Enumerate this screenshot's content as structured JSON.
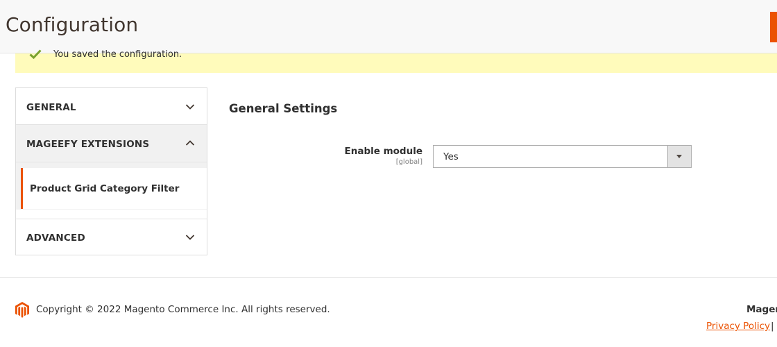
{
  "header": {
    "title": "Configuration"
  },
  "message": {
    "text": "You saved the configuration."
  },
  "sidebar": {
    "sections": [
      {
        "label": "GENERAL",
        "expanded": false
      },
      {
        "label": "MAGEEFY EXTENSIONS",
        "expanded": true,
        "items": [
          {
            "label": "Product Grid Category Filter",
            "active": true
          }
        ]
      },
      {
        "label": "ADVANCED",
        "expanded": false
      }
    ]
  },
  "main": {
    "section_title": "General Settings",
    "field": {
      "label": "Enable module",
      "scope": "[global]",
      "value": "Yes"
    }
  },
  "footer": {
    "copyright": "Copyright © 2022 Magento Commerce Inc. All rights reserved.",
    "brand": "Mager",
    "privacy_link": "Privacy Policy",
    "separator": "|"
  },
  "colors": {
    "accent": "#eb5202",
    "message_bg": "#fffbbb",
    "success": "#79a22e"
  }
}
